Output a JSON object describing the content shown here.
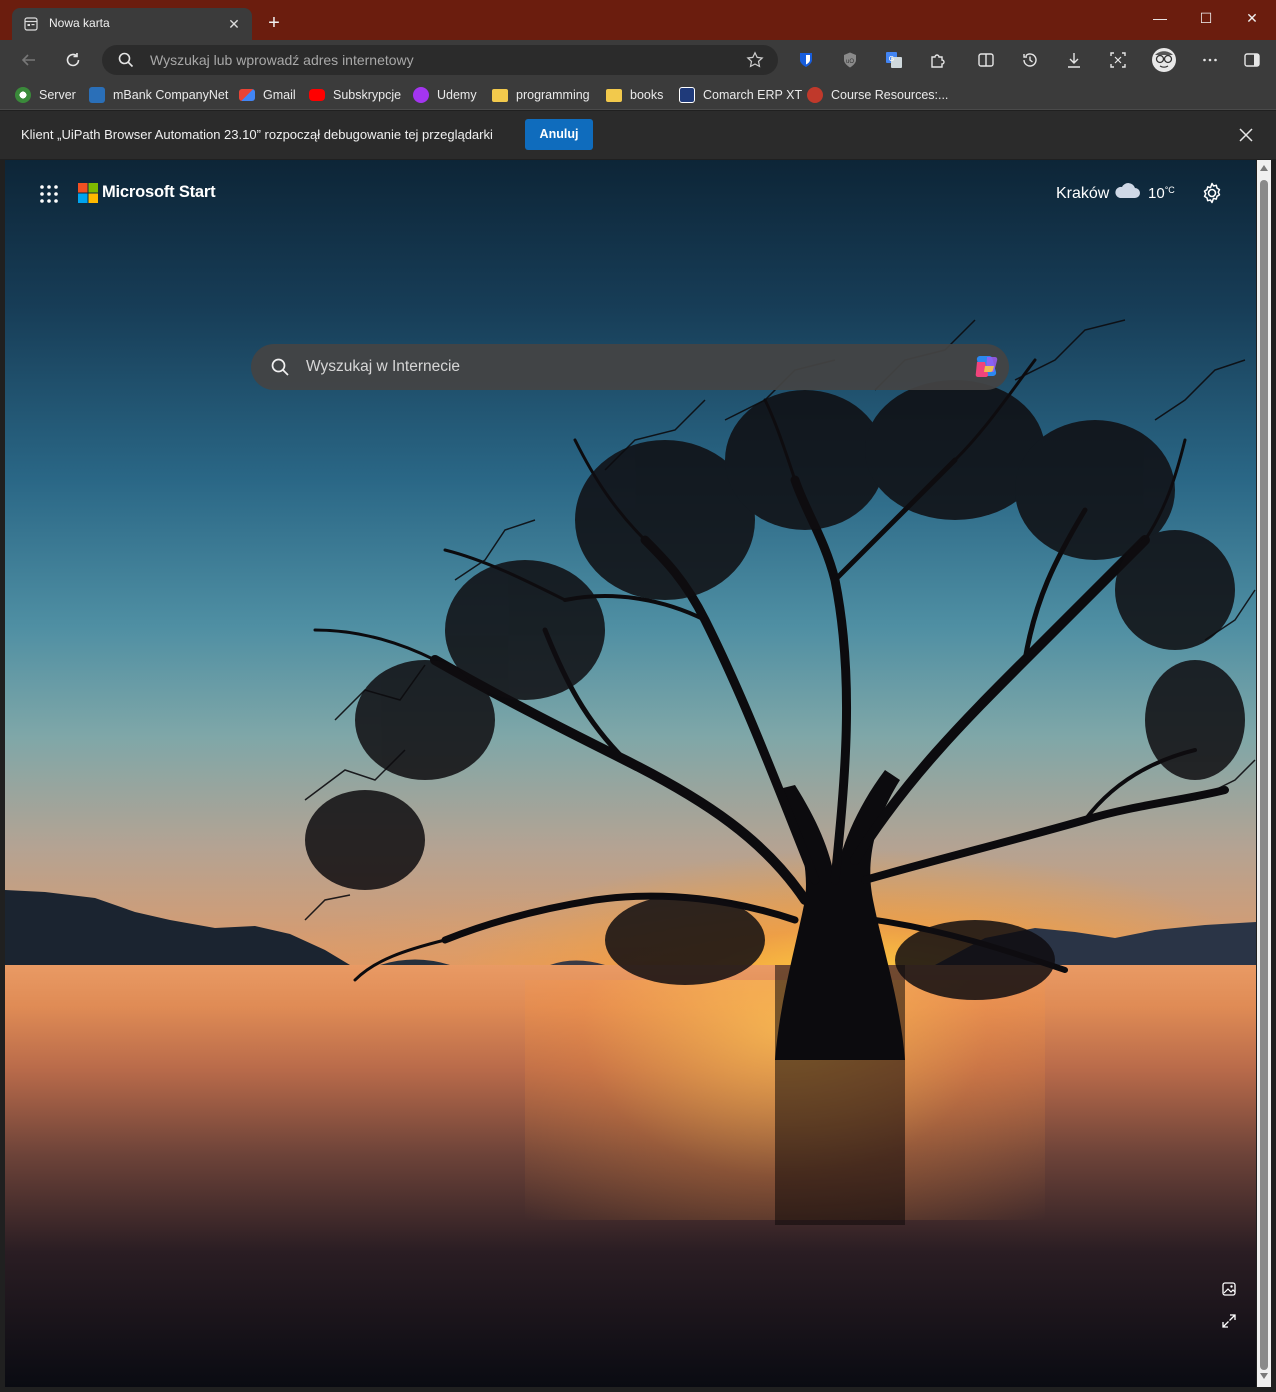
{
  "tab": {
    "title": "Nowa karta",
    "close_icon": "close-icon",
    "new_tab_symbol": "+"
  },
  "window_controls": {
    "minimize": "—",
    "maximize": "☐",
    "close": "✕"
  },
  "toolbar": {
    "address_placeholder": "Wyszukaj lub wprowadź adres internetowy",
    "icons": [
      "back-icon",
      "refresh-icon",
      "search-icon",
      "favorite-star-icon",
      "bitwarden-icon",
      "ublock-icon",
      "translate-icon",
      "extensions-icon",
      "split-screen-icon",
      "history-icon",
      "downloads-icon",
      "screenshot-icon",
      "profile-avatar-icon",
      "more-icon",
      "sidebar-icon"
    ]
  },
  "bookmarks": [
    {
      "label": "Server",
      "color": "#3a8a3a"
    },
    {
      "label": "mBank CompanyNet",
      "color": "#2a6fb8"
    },
    {
      "label": "Gmail",
      "color": "#ea4335"
    },
    {
      "label": "Subskrypcje",
      "color": "#ff0000"
    },
    {
      "label": "Udemy",
      "color": "#a435f0"
    },
    {
      "label": "programming",
      "color": "#f2c94c"
    },
    {
      "label": "books",
      "color": "#f2c94c"
    },
    {
      "label": "Comarch ERP XT",
      "color": "#1f3a7a"
    },
    {
      "label": "Course Resources:...",
      "color": "#c0392b"
    }
  ],
  "infobar": {
    "message": "Klient „UiPath Browser Automation 23.10” rozpoczął debugowanie tej przeglądarki",
    "cancel_label": "Anuluj"
  },
  "newtab": {
    "brand": "Microsoft Start",
    "weather": {
      "city": "Kraków",
      "temperature": "10",
      "unit": "°C"
    },
    "search_placeholder": "Wyszukaj w Internecie"
  },
  "colors": {
    "titlebar": "#6b1d0e",
    "accent": "#0f6cbd",
    "toolbar": "#3b3b3b"
  }
}
